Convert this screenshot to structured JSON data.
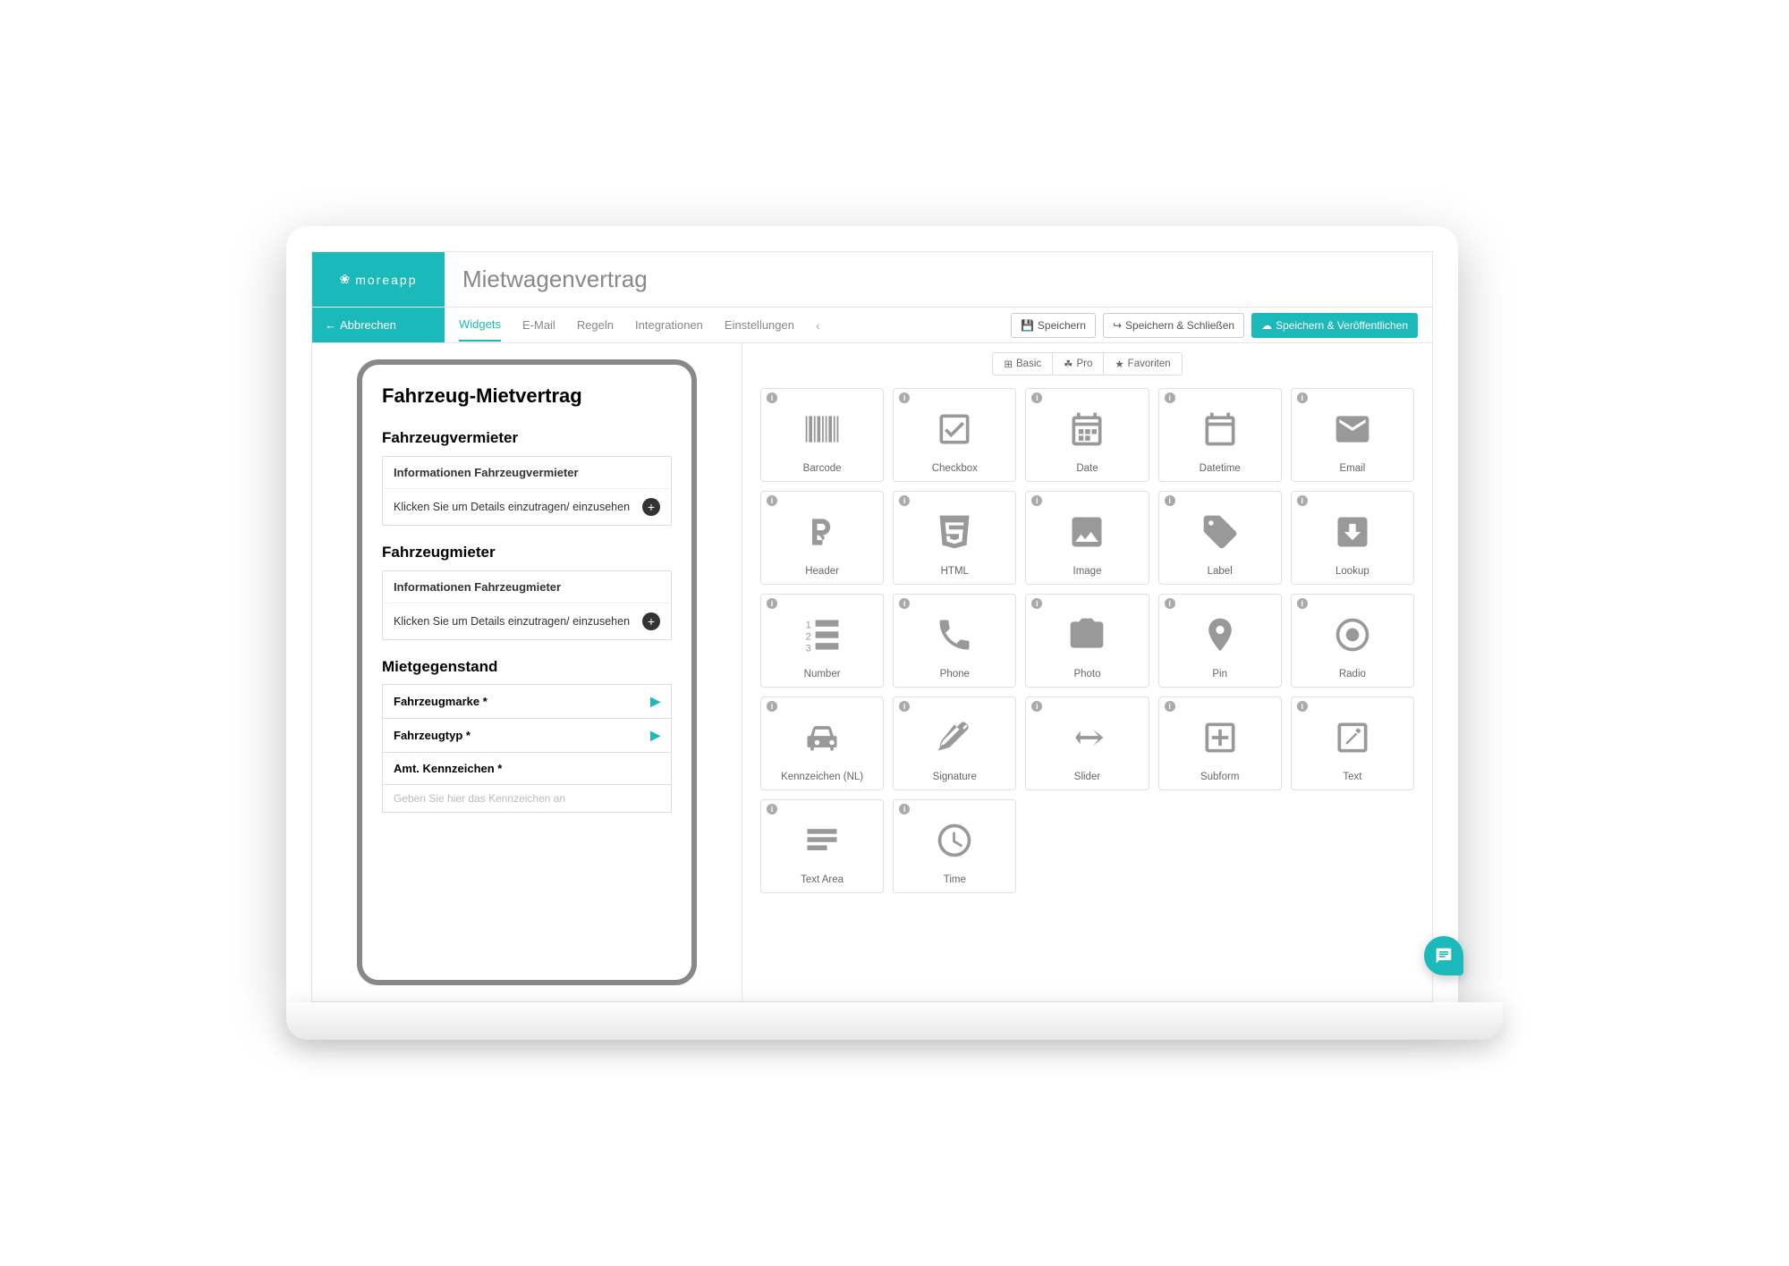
{
  "brand": "moreapp",
  "page_title": "Mietwagenvertrag",
  "cancel_label": "Abbrechen",
  "tabs": {
    "widgets": "Widgets",
    "email": "E-Mail",
    "rules": "Regeln",
    "integrations": "Integrationen",
    "settings": "Einstellungen"
  },
  "actions": {
    "save": "Speichern",
    "save_close": "Speichern & Schließen",
    "save_publish": "Speichern & Veröffentlichen"
  },
  "form": {
    "title": "Fahrzeug-Mietvertrag",
    "sec1": {
      "heading": "Fahrzeugvermieter",
      "item_title": "Informationen Fahrzeugvermieter",
      "expand": "Klicken Sie um Details einzutragen/ einzusehen"
    },
    "sec2": {
      "heading": "Fahrzeugmieter",
      "item_title": "Informationen Fahrzeugmieter",
      "expand": "Klicken Sie um Details einzutragen/ einzusehen"
    },
    "sec3": {
      "heading": "Mietgegenstand",
      "f1": "Fahrzeugmarke *",
      "f2": "Fahrzeugtyp *",
      "f3": "Amt. Kennzeichen *",
      "f3_placeholder": "Geben Sie hier das Kennzeichen an"
    }
  },
  "filters": {
    "basic": "Basic",
    "pro": "Pro",
    "fav": "Favoriten"
  },
  "widgets": [
    {
      "id": "barcode",
      "label": "Barcode"
    },
    {
      "id": "checkbox",
      "label": "Checkbox"
    },
    {
      "id": "date",
      "label": "Date"
    },
    {
      "id": "datetime",
      "label": "Datetime"
    },
    {
      "id": "email",
      "label": "Email"
    },
    {
      "id": "header",
      "label": "Header"
    },
    {
      "id": "html",
      "label": "HTML"
    },
    {
      "id": "image",
      "label": "Image"
    },
    {
      "id": "label",
      "label": "Label"
    },
    {
      "id": "lookup",
      "label": "Lookup"
    },
    {
      "id": "number",
      "label": "Number"
    },
    {
      "id": "phone",
      "label": "Phone"
    },
    {
      "id": "photo",
      "label": "Photo"
    },
    {
      "id": "pin",
      "label": "Pin"
    },
    {
      "id": "radio",
      "label": "Radio"
    },
    {
      "id": "licenseplate",
      "label": "Kennzeichen (NL)"
    },
    {
      "id": "signature",
      "label": "Signature"
    },
    {
      "id": "slider",
      "label": "Slider"
    },
    {
      "id": "subform",
      "label": "Subform"
    },
    {
      "id": "text",
      "label": "Text"
    },
    {
      "id": "textarea",
      "label": "Text Area"
    },
    {
      "id": "time",
      "label": "Time"
    }
  ],
  "icons": {
    "barcode": "<svg viewBox='0 0 24 24'><path d='M2 4h1v16H2zM4 4h2v16H4zM7 4h1v16H7zM9 4h2v16H9zM12 4h1v16h-1zM14 4h1v16h-1zM16 4h2v16h-2zM19 4h1v16h-1zM21 4h1v16h-1z'/></svg>",
    "checkbox": "<svg viewBox='0 0 24 24'><path d='M19 3H5a2 2 0 00-2 2v14a2 2 0 002 2h14a2 2 0 002-2V5a2 2 0 00-2-2zm0 16H5V5h14zM10 17l-4-4 1.4-1.4L10 14.2l6.6-6.6L18 9z'/></svg>",
    "date": "<svg viewBox='0 0 24 24'><path d='M19 4h-1V2h-2v2H8V2H6v2H5a2 2 0 00-2 2v14a2 2 0 002 2h14a2 2 0 002-2V6a2 2 0 00-2-2zm0 16H5V10h14zM5 8V6h14v2zM7 12h3v3H7zM11 12h3v3h-3zM15 12h3v3h-3zM7 16h3v3H7zM11 16h3v3h-3z'/></svg>",
    "datetime": "<svg viewBox='0 0 24 24'><path d='M19 4h-1V2h-2v2H8V2H6v2H5a2 2 0 00-2 2v14a2 2 0 002 2h14a2 2 0 002-2V6a2 2 0 00-2-2zm0 16H5V10h14zM5 8V6h14v2z'/></svg>",
    "email": "<svg viewBox='0 0 24 24'><path d='M20 4H4a2 2 0 00-2 2v12a2 2 0 002 2h16a2 2 0 002-2V6a2 2 0 00-2-2zm0 4l-8 5-8-5V6l8 5 8-5z'/></svg>",
    "header": "<svg viewBox='0 0 24 24'><path d='M6 4h6a5 5 0 010 10h-2v.04A5 5 0 0112 20H6V4zm3 3v4h3a2 2 0 000-4H9zm0 7v3h3a1.5 1.5 0 000-3H9z'/></svg>",
    "html": "<svg viewBox='0 0 24 24'><path d='M3 2l1.6 18L12 22l7.4-2L21 2H3zm14.5 6H8.5l.2 2.5h8.6l-.7 7.3L12 19.2l-4.6-1.4-.3-3.3h2.2l.15 1.7 2.55.7 2.55-.7.3-3H7l-.6-7h11.3z'/></svg>",
    "image": "<svg viewBox='0 0 24 24'><path d='M21 19V5a2 2 0 00-2-2H5a2 2 0 00-2 2v14a2 2 0 002 2h14a2 2 0 002-2zM8.5 13.5l2.5 3 3.5-4.5 4.5 6H5z'/></svg>",
    "label": "<svg viewBox='0 0 24 24'><path d='M21.4 11.6l-9-9A2 2 0 0011 2H4a2 2 0 00-2 2v7a2 2 0 00.6 1.4l9 9a2 2 0 002.8 0l7-7a2 2 0 000-2.8zM6.5 8A1.5 1.5 0 118 6.5 1.5 1.5 0 016.5 8z'/></svg>",
    "lookup": "<svg viewBox='0 0 24 24'><path d='M19 3H5a2 2 0 00-2 2v14a2 2 0 002 2h14a2 2 0 002-2V5a2 2 0 00-2-2zm-7 14l-5-5h3V7h4v5h3z'/></svg>",
    "number": "<svg viewBox='0 0 24 24'><text x='2' y='8' font-size='6' fill='#999'>1</text><text x='2' y='15' font-size='6' fill='#999'>2</text><text x='2' y='22' font-size='6' fill='#999'>3</text><rect x='8' y='3' width='14' height='4'/><rect x='8' y='10' width='14' height='4'/><rect x='8' y='17' width='14' height='4'/></svg>",
    "phone": "<svg viewBox='0 0 24 24'><path d='M6.6 10.8a15 15 0 006.6 6.6l2.2-2.2a1 1 0 011-.25 11.4 11.4 0 003.6.6 1 1 0 011 1V20a1 1 0 01-1 1A17 17 0 013 4a1 1 0 011-1h3.5a1 1 0 011 1 11.4 11.4 0 00.6 3.6 1 1 0 01-.25 1z'/></svg>",
    "photo": "<svg viewBox='0 0 24 24'><path d='M12 17a5 5 0 100-10 5 5 0 000 10zm0-2a3 3 0 110-6 3 3 0 010 6zm8-11h-3.2l-1.8-2H9L7.2 4H4a2 2 0 00-2 2v12a2 2 0 002 2h16a2 2 0 002-2V6a2 2 0 00-2-2z'/></svg>",
    "pin": "<svg viewBox='0 0 24 24'><path d='M12 2a7 7 0 00-7 7c0 5.25 7 13 7 13s7-7.75 7-13a7 7 0 00-7-7zm0 9.5A2.5 2.5 0 1114.5 9 2.5 2.5 0 0112 11.5z'/></svg>",
    "radio": "<svg viewBox='0 0 24 24'><path d='M12 2a10 10 0 1010 10A10 10 0 0012 2zm0 18a8 8 0 118-8 8 8 0 01-8 8zm0-12a4 4 0 104 4 4 4 0 00-4-4z'/></svg>",
    "licenseplate": "<svg viewBox='0 0 24 24'><path d='M5 11l1.5-4.5A2 2 0 018.4 5h7.2a2 2 0 011.9 1.5L19 11h1a1 1 0 011 1v5a1 1 0 01-1 1h-1v1a1 1 0 01-2 0v-1H7v1a1 1 0 01-2 0v-1H4a1 1 0 01-1-1v-5a1 1 0 011-1zm2.5 4A1.5 1.5 0 109 13.5 1.5 1.5 0 007.5 15zm9 0a1.5 1.5 0 101.5-1.5 1.5 1.5 0 00-1.5 1.5zM7 11h10l-1-4H8z'/></svg>",
    "signature": "<svg viewBox='0 0 24 24'><path d='M2 20l7-2 11-11a2 2 0 000-2.8L18.8 3a2 2 0 00-2.8 0L5 14l-3 6zm17-16l1 1-2 2-1-1zM12 4l3 3-9 9-3 1 1-3z'/></svg>",
    "slider": "<svg viewBox='0 0 24 24'><path d='M2 12h3l3-4v3h11l-3-4 6 5-6 5 3-4H8v3l-3-4H2z'/></svg>",
    "subform": "<svg viewBox='0 0 24 24'><path d='M19 3H5a2 2 0 00-2 2v14a2 2 0 002 2h14a2 2 0 002-2V5a2 2 0 00-2-2zm0 16H5V5h14zM11 7h2v4h4v2h-4v4h-2v-4H7v-2h4z'/></svg>",
    "text": "<svg viewBox='0 0 24 24'><path d='M19 3H5a2 2 0 00-2 2v14a2 2 0 002 2h14a2 2 0 002-2V5a2 2 0 00-2-2zm0 16H5V5h14zM14.06 9.02l.92.92L8.92 16H8v-.92zM17 7.9a.6.6 0 01-.18.43l-1.2 1.2-1.85-1.85 1.2-1.2a.6.6 0 01.85 0l1 1A.6.6 0 0117 7.9z'/></svg>",
    "textarea": "<svg viewBox='0 0 24 24'><rect x='3' y='5' width='18' height='3'/><rect x='3' y='10' width='18' height='3'/><rect x='3' y='15' width='12' height='3'/></svg>",
    "time": "<svg viewBox='0 0 24 24'><path d='M12 2a10 10 0 1010 10A10 10 0 0012 2zm0 18a8 8 0 118-8 8 8 0 01-8 8zm.5-13H11v6l5.2 3.1.8-1.3-4.5-2.7z'/></svg>"
  }
}
